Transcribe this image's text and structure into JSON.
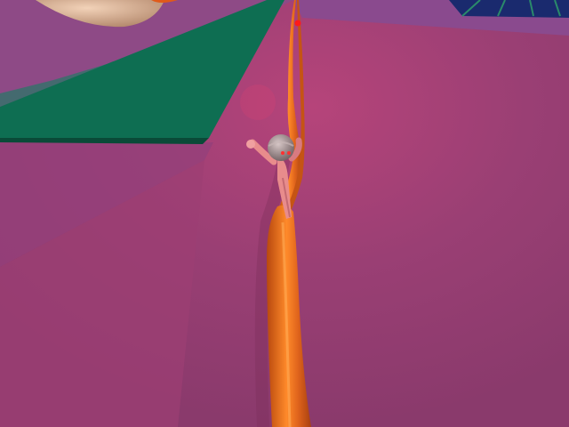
{
  "scene": {
    "colors": {
      "floor": "#a0466e",
      "floor_far": "#8c4a86",
      "green_platform": "#0e6e52",
      "rail": "#e0641c",
      "rail_highlight": "#ff9a3c",
      "character_body": "#e88c8c",
      "character_head": "#9a8a8a",
      "ball": "#d8b49a",
      "background_structure": "#1a2a6e",
      "marker": "#ff1a1a"
    }
  }
}
